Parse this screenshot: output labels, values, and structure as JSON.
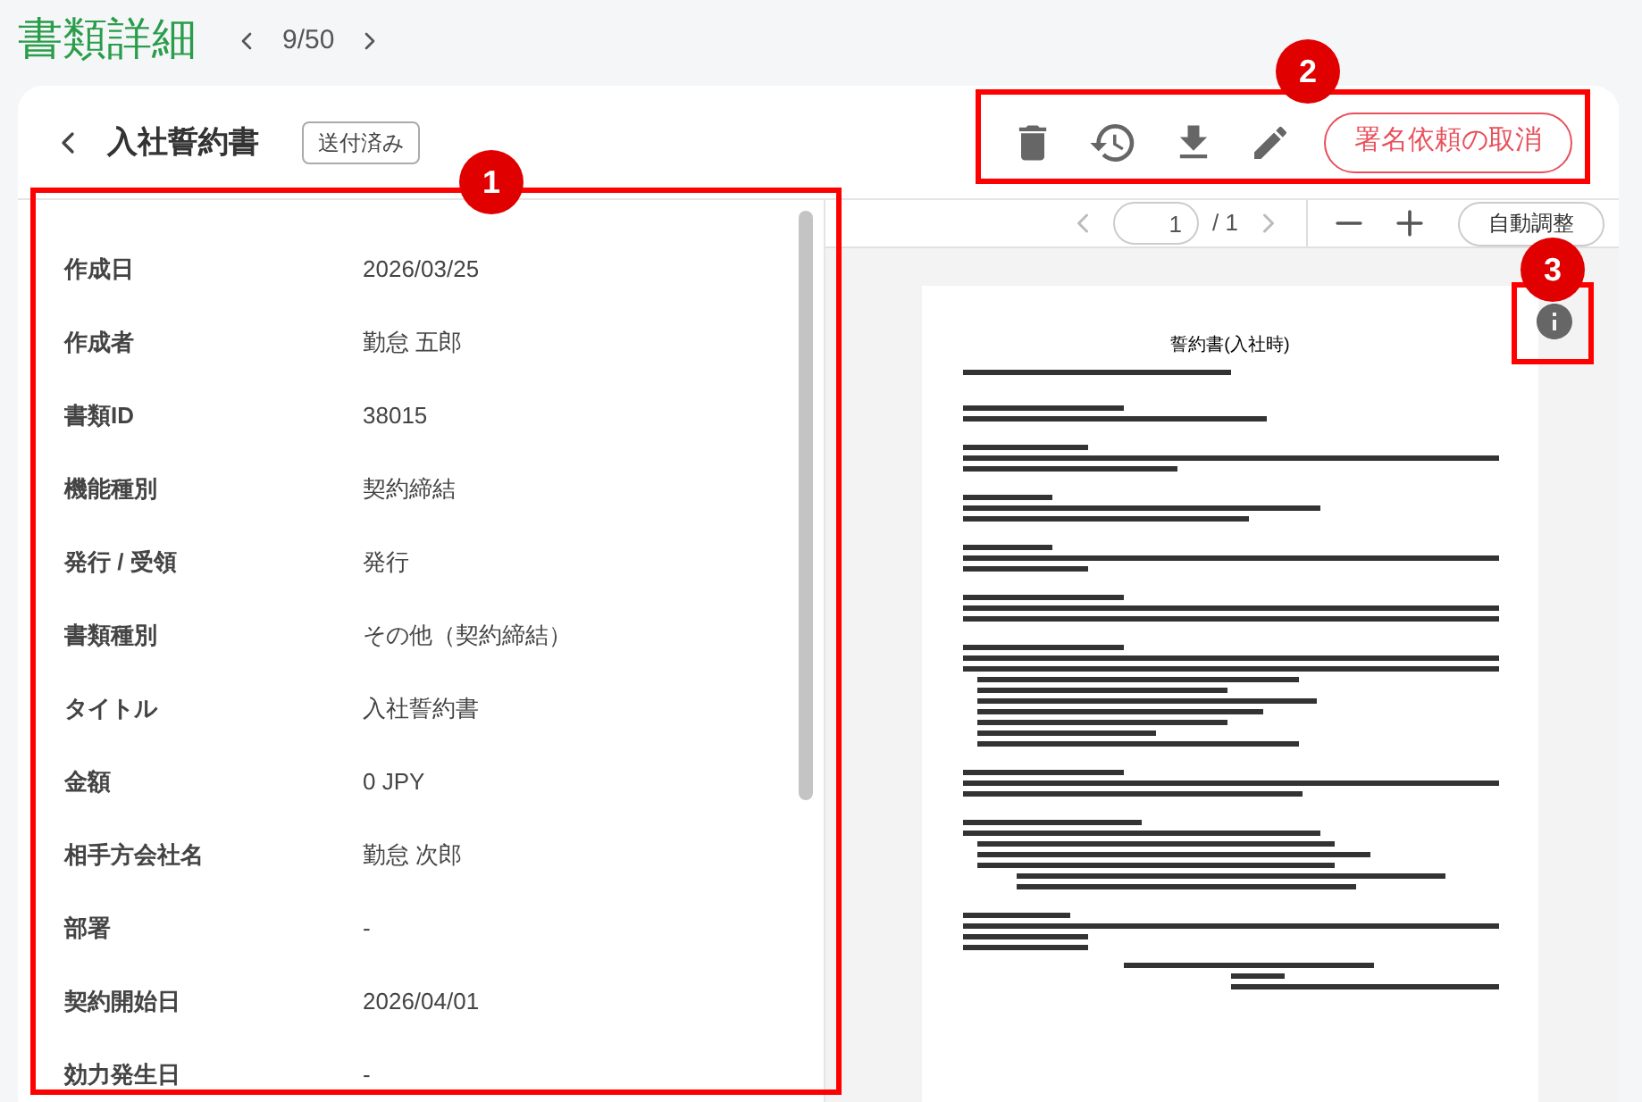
{
  "page_title": "書類詳細",
  "pager": {
    "position": "9/50"
  },
  "document": {
    "title": "入社誓約書",
    "status": "送付済み"
  },
  "actions": {
    "cancel_button": "署名依頼の取消"
  },
  "fields": [
    {
      "label": "作成日",
      "value": "2026/03/25"
    },
    {
      "label": "作成者",
      "value": "勤怠 五郎"
    },
    {
      "label": "書類ID",
      "value": "38015"
    },
    {
      "label": "機能種別",
      "value": "契約締結"
    },
    {
      "label": "発行 / 受領",
      "value": "発行"
    },
    {
      "label": "書類種別",
      "value": "その他（契約締結）"
    },
    {
      "label": "タイトル",
      "value": "入社誓約書"
    },
    {
      "label": "金額",
      "value": "0 JPY"
    },
    {
      "label": "相手方会社名",
      "value": "勤怠 次郎"
    },
    {
      "label": "部署",
      "value": "-"
    },
    {
      "label": "契約開始日",
      "value": "2026/04/01"
    },
    {
      "label": "効力発生日",
      "value": "-"
    }
  ],
  "viewer": {
    "page_value": "1",
    "page_total": "/ 1",
    "fit_button": "自動調整",
    "preview_title": "誓約書(入社時)"
  },
  "annotations": [
    {
      "number": "1"
    },
    {
      "number": "2"
    },
    {
      "number": "3"
    }
  ]
}
